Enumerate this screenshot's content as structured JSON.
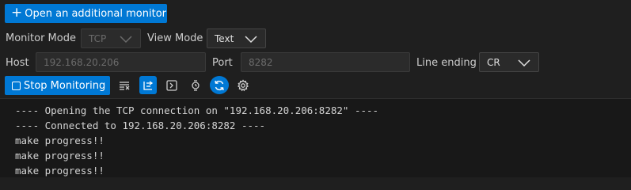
{
  "toolbar": {
    "open_monitor_label": "Open an additional monitor"
  },
  "settings": {
    "monitor_mode_label": "Monitor Mode",
    "monitor_mode_value": "TCP",
    "view_mode_label": "View Mode",
    "view_mode_value": "Text",
    "host_label": "Host",
    "host_value": "192.168.20.206",
    "port_label": "Port",
    "port_value": "8282",
    "line_ending_label": "Line ending",
    "line_ending_value": "CR"
  },
  "controls": {
    "stop_label": "Stop Monitoring",
    "icons": [
      "clear-output-icon",
      "autoscroll-toggle-icon",
      "terminal-icon",
      "timestamp-icon",
      "reconnect-icon",
      "settings-gear-icon"
    ]
  },
  "colors": {
    "accent": "#0078d4",
    "background": "#1f1f1f",
    "output_background": "#181818"
  },
  "output": {
    "lines": [
      "---- Opening the TCP connection on \"192.168.20.206:8282\" ----",
      "---- Connected to 192.168.20.206:8282 ----",
      "make progress!!",
      "make progress!!",
      "make progress!!"
    ]
  }
}
